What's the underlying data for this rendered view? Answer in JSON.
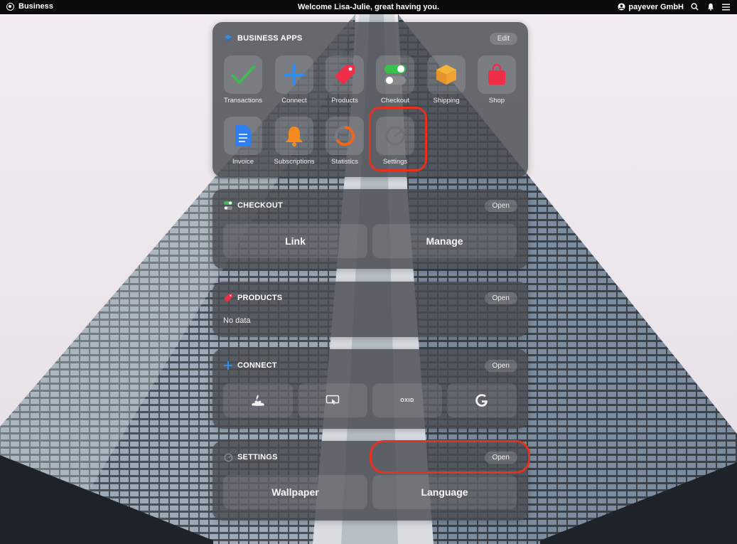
{
  "topbar": {
    "brand": "Business",
    "welcome": "Welcome Lisa-Julie, great having you.",
    "company": "payever GmbH"
  },
  "business_apps": {
    "title": "BUSINESS APPS",
    "edit_label": "Edit",
    "apps": [
      {
        "label": "Transactions",
        "icon": "checkmark-icon"
      },
      {
        "label": "Connect",
        "icon": "plus-icon"
      },
      {
        "label": "Products",
        "icon": "tag-icon"
      },
      {
        "label": "Checkout",
        "icon": "toggles-icon"
      },
      {
        "label": "Shipping",
        "icon": "box-icon"
      },
      {
        "label": "Shop",
        "icon": "shopping-bag-icon"
      },
      {
        "label": "Invoice",
        "icon": "document-icon"
      },
      {
        "label": "Subscriptions",
        "icon": "bell-icon"
      },
      {
        "label": "Statistics",
        "icon": "ring-chart-icon"
      },
      {
        "label": "Settings",
        "icon": "gauge-icon"
      }
    ]
  },
  "checkout": {
    "title": "CHECKOUT",
    "open_label": "Open",
    "buttons": [
      "Link",
      "Manage"
    ]
  },
  "products": {
    "title": "PRODUCTS",
    "open_label": "Open",
    "empty_text": "No data"
  },
  "connect": {
    "title": "CONNECT",
    "open_label": "Open",
    "integrations": [
      "santander-logo-icon",
      "screen-pointer-icon",
      "oxid-logo-icon",
      "google-logo-icon"
    ],
    "oxid_text": "OXID"
  },
  "settings": {
    "title": "SETTINGS",
    "open_label": "Open",
    "buttons": [
      "Wallpaper",
      "Language"
    ]
  },
  "colors": {
    "highlight": "#e8301f",
    "card_bg": "#484a50",
    "topbar_bg": "#0b0b0c"
  }
}
